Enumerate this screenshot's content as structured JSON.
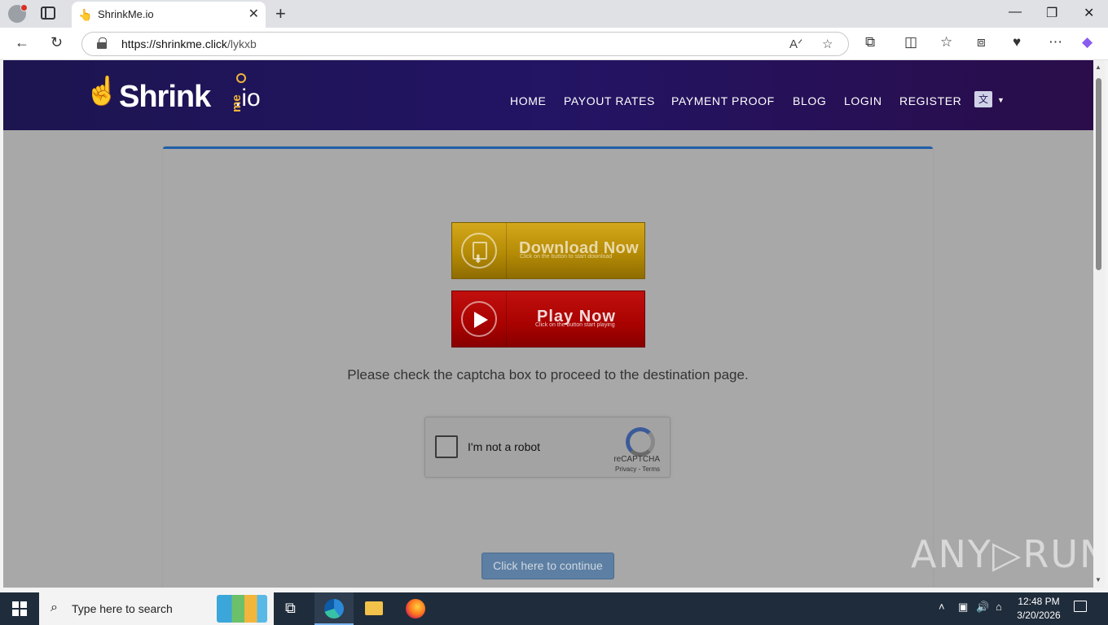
{
  "browser": {
    "tab_title": "ShrinkMe.io",
    "tab_favicon": "👆",
    "url_host": "https://shrinkme.click",
    "url_path": "/lykxb",
    "read_aloud_label": "Aͅ"
  },
  "site": {
    "logo_main": "Shrink",
    "logo_me": "me",
    "logo_tld": ".io",
    "nav": [
      "HOME",
      "PAYOUT RATES",
      "PAYMENT PROOF",
      "BLOG",
      "LOGIN",
      "REGISTER"
    ],
    "language_icon": "translate-icon"
  },
  "content": {
    "download_button": {
      "title": "Download Now",
      "subtitle": "Click on the button to start download"
    },
    "play_button": {
      "title": "Play Now",
      "subtitle": "Click on the button start playing"
    },
    "notice": "Please check the captcha box to proceed to the destination page.",
    "captcha": {
      "label": "I'm not a robot",
      "brand": "reCAPTCHA",
      "links": "Privacy - Terms",
      "checked": false
    },
    "continue_button": "Click here to continue"
  },
  "watermark": "ANY▷RUN",
  "taskbar": {
    "search_placeholder": "Type here to search",
    "time": "12:48 PM",
    "date": "3/20/2026"
  },
  "colors": {
    "header_bg": "#231464",
    "card_accent": "#1f5fa8",
    "download_gold": "#b58b06",
    "play_red": "#a80200",
    "continue_blue": "#5d7fa3"
  }
}
